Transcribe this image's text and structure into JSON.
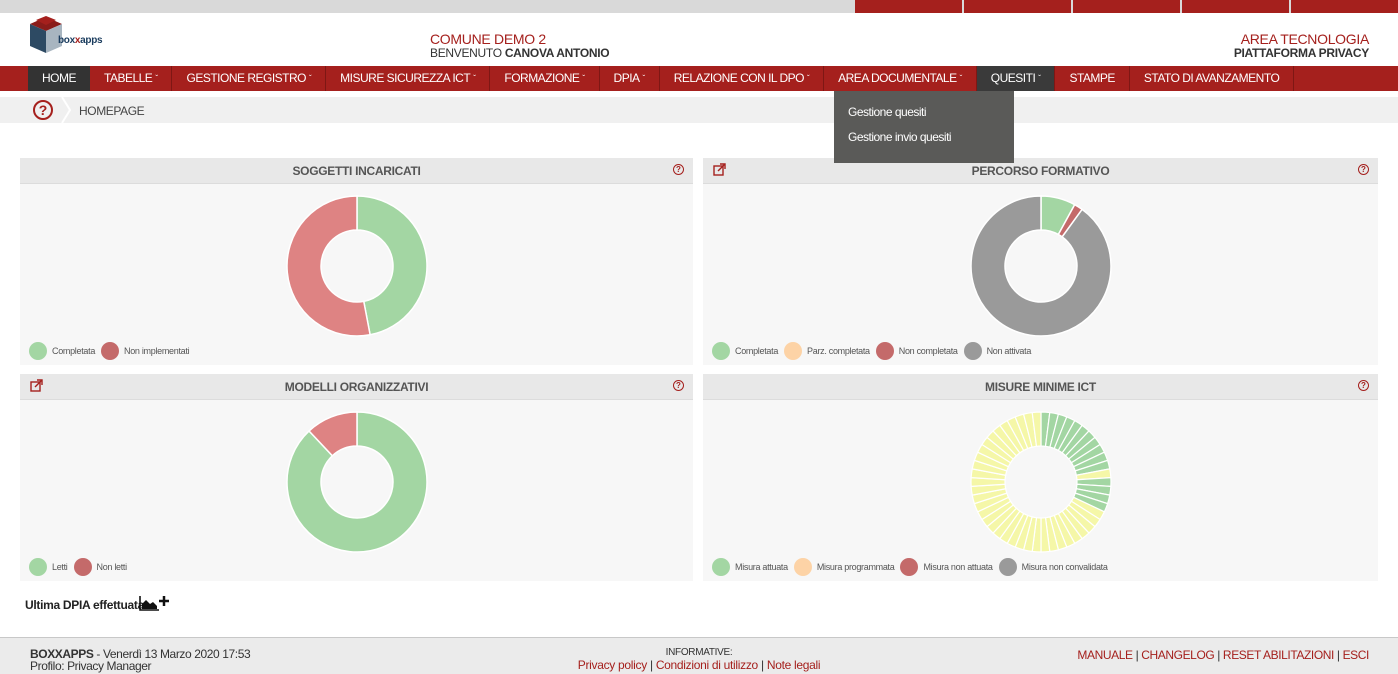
{
  "header": {
    "logo_text_a": "box",
    "logo_text_b": "x",
    "logo_text_c": "apps",
    "ente": "COMUNE DEMO 2",
    "welcome_prefix": "BENVENUTO",
    "user_name": "CANOVA ANTONIO",
    "area": "AREA TECNOLOGIA",
    "platform": "PIATTAFORMA PRIVACY"
  },
  "nav": {
    "items": [
      {
        "label": "HOME",
        "has_chevron": false
      },
      {
        "label": "TABELLE",
        "has_chevron": true
      },
      {
        "label": "GESTIONE REGISTRO",
        "has_chevron": true
      },
      {
        "label": "MISURE SICUREZZA ICT",
        "has_chevron": true
      },
      {
        "label": "FORMAZIONE",
        "has_chevron": true
      },
      {
        "label": "DPIA",
        "has_chevron": true
      },
      {
        "label": "RELAZIONE CON IL DPO",
        "has_chevron": true
      },
      {
        "label": "AREA DOCUMENTALE",
        "has_chevron": true
      },
      {
        "label": "QUESITI",
        "has_chevron": true
      },
      {
        "label": "STAMPE",
        "has_chevron": false
      },
      {
        "label": "STATO DI AVANZAMENTO",
        "has_chevron": false
      }
    ],
    "chevron": "ˇ",
    "dropdown": [
      "Gestione quesiti",
      "Gestione invio quesiti"
    ]
  },
  "breadcrumb": {
    "help_glyph": "?",
    "label": "HOMEPAGE"
  },
  "panels": {
    "soggetti": {
      "title": "SOGGETTI INCARICATI",
      "legend": [
        {
          "label": "Completata",
          "color": "#a3d6a3"
        },
        {
          "label": "Non implementati",
          "color": "#c46a6a"
        }
      ]
    },
    "percorso": {
      "title": "PERCORSO FORMATIVO",
      "legend": [
        {
          "label": "Completata",
          "color": "#a3d6a3"
        },
        {
          "label": "Parz. completata",
          "color": "#fdd3a6"
        },
        {
          "label": "Non completata",
          "color": "#c46a6a"
        },
        {
          "label": "Non attivata",
          "color": "#9a9a9a"
        }
      ]
    },
    "modelli": {
      "title": "MODELLI ORGANIZZATIVI",
      "legend": [
        {
          "label": "Letti",
          "color": "#a3d6a3"
        },
        {
          "label": "Non letti",
          "color": "#c46a6a"
        }
      ]
    },
    "misure": {
      "title": "MISURE MINIME ICT",
      "legend": [
        {
          "label": "Misura attuata",
          "color": "#a3d6a3"
        },
        {
          "label": "Misura programmata",
          "color": "#fdd3a6"
        },
        {
          "label": "Misura non attuata",
          "color": "#c46a6a"
        },
        {
          "label": "Misura non convalidata",
          "color": "#9a9a9a"
        }
      ]
    },
    "help_glyph": "?"
  },
  "chart_data": [
    {
      "type": "pie",
      "title": "SOGGETTI INCARICATI",
      "slices": [
        {
          "name": "Completata",
          "value": 47,
          "color": "#a3d6a3"
        },
        {
          "name": "Non implementati",
          "value": 53,
          "color": "#de8383"
        }
      ]
    },
    {
      "type": "pie",
      "title": "PERCORSO FORMATIVO",
      "slices": [
        {
          "name": "Completata",
          "value": 8,
          "color": "#a3d6a3"
        },
        {
          "name": "Non completata",
          "value": 2,
          "color": "#c46a6a"
        },
        {
          "name": "Non attivata",
          "value": 90,
          "color": "#9a9a9a"
        }
      ]
    },
    {
      "type": "pie",
      "title": "MODELLI ORGANIZZATIVI",
      "slices": [
        {
          "name": "Letti",
          "value": 88,
          "color": "#a3d6a3"
        },
        {
          "name": "Non letti",
          "value": 12,
          "color": "#de8383"
        }
      ]
    },
    {
      "type": "pie",
      "title": "MISURE MINIME ICT",
      "slices": [
        {
          "name": "Misura attuata",
          "value": 1,
          "color": "#a3d6a3"
        },
        {
          "name": "Misura attuata",
          "value": 1,
          "color": "#a3d6a3"
        },
        {
          "name": "Misura attuata",
          "value": 1,
          "color": "#a3d6a3"
        },
        {
          "name": "Misura attuata",
          "value": 1,
          "color": "#a3d6a3"
        },
        {
          "name": "Misura attuata",
          "value": 1,
          "color": "#a3d6a3"
        },
        {
          "name": "Misura attuata",
          "value": 1,
          "color": "#a3d6a3"
        },
        {
          "name": "Misura attuata",
          "value": 1,
          "color": "#a3d6a3"
        },
        {
          "name": "Misura attuata",
          "value": 1,
          "color": "#a3d6a3"
        },
        {
          "name": "Misura attuata",
          "value": 1,
          "color": "#a3d6a3"
        },
        {
          "name": "Misura attuata",
          "value": 1,
          "color": "#a3d6a3"
        },
        {
          "name": "Misura attuata",
          "value": 1,
          "color": "#a3d6a3"
        },
        {
          "name": "Misura programmata",
          "value": 1,
          "color": "#f5f7a8"
        },
        {
          "name": "Misura attuata",
          "value": 1,
          "color": "#a3d6a3"
        },
        {
          "name": "Misura attuata",
          "value": 1,
          "color": "#a3d6a3"
        },
        {
          "name": "Misura attuata",
          "value": 1,
          "color": "#a3d6a3"
        },
        {
          "name": "Misura attuata",
          "value": 1,
          "color": "#a3d6a3"
        },
        {
          "name": "Misura programmata",
          "value": 1,
          "color": "#f5f7a8"
        },
        {
          "name": "Misura programmata",
          "value": 1,
          "color": "#f5f7a8"
        },
        {
          "name": "Misura programmata",
          "value": 1,
          "color": "#f5f7a8"
        },
        {
          "name": "Misura programmata",
          "value": 1,
          "color": "#f5f7a8"
        },
        {
          "name": "Misura programmata",
          "value": 1,
          "color": "#f5f7a8"
        },
        {
          "name": "Misura programmata",
          "value": 1,
          "color": "#f5f7a8"
        },
        {
          "name": "Misura programmata",
          "value": 1,
          "color": "#f5f7a8"
        },
        {
          "name": "Misura programmata",
          "value": 1,
          "color": "#f5f7a8"
        },
        {
          "name": "Misura programmata",
          "value": 1,
          "color": "#f5f7a8"
        },
        {
          "name": "Misura programmata",
          "value": 1,
          "color": "#f5f7a8"
        },
        {
          "name": "Misura programmata",
          "value": 1,
          "color": "#f5f7a8"
        },
        {
          "name": "Misura programmata",
          "value": 1,
          "color": "#f5f7a8"
        },
        {
          "name": "Misura programmata",
          "value": 1,
          "color": "#f5f7a8"
        },
        {
          "name": "Misura programmata",
          "value": 1,
          "color": "#f5f7a8"
        },
        {
          "name": "Misura programmata",
          "value": 1,
          "color": "#f5f7a8"
        },
        {
          "name": "Misura programmata",
          "value": 1,
          "color": "#f5f7a8"
        },
        {
          "name": "Misura programmata",
          "value": 1,
          "color": "#f5f7a8"
        },
        {
          "name": "Misura programmata",
          "value": 1,
          "color": "#f5f7a8"
        },
        {
          "name": "Misura programmata",
          "value": 1,
          "color": "#f5f7a8"
        },
        {
          "name": "Misura programmata",
          "value": 1,
          "color": "#f5f7a8"
        },
        {
          "name": "Misura programmata",
          "value": 1,
          "color": "#f5f7a8"
        },
        {
          "name": "Misura programmata",
          "value": 1,
          "color": "#f5f7a8"
        },
        {
          "name": "Misura programmata",
          "value": 1,
          "color": "#f5f7a8"
        },
        {
          "name": "Misura programmata",
          "value": 1,
          "color": "#f5f7a8"
        },
        {
          "name": "Misura programmata",
          "value": 1,
          "color": "#f5f7a8"
        },
        {
          "name": "Misura programmata",
          "value": 1,
          "color": "#f5f7a8"
        },
        {
          "name": "Misura programmata",
          "value": 1,
          "color": "#f5f7a8"
        },
        {
          "name": "Misura programmata",
          "value": 1,
          "color": "#f5f7a8"
        },
        {
          "name": "Misura programmata",
          "value": 1,
          "color": "#f5f7a8"
        },
        {
          "name": "Misura programmata",
          "value": 1,
          "color": "#f5f7a8"
        },
        {
          "name": "Misura programmata",
          "value": 1,
          "color": "#f5f7a8"
        },
        {
          "name": "Misura programmata",
          "value": 1,
          "color": "#f5f7a8"
        },
        {
          "name": "Misura programmata",
          "value": 1,
          "color": "#f5f7a8"
        },
        {
          "name": "Misura programmata",
          "value": 1,
          "color": "#f5f7a8"
        }
      ]
    }
  ],
  "dpia": {
    "label": "Ultima DPIA effettuata"
  },
  "footer": {
    "brand": "BOXXAPPS",
    "datetime": " - Venerdì 13 Marzo 2020 17:53",
    "profile": "Profilo: Privacy Manager",
    "informative": "INFORMATIVE:",
    "privacy": "Privacy policy",
    "conditions": "Condizioni di utilizzo",
    "legal": "Note legali",
    "manual": "MANUALE",
    "changelog": "CHANGELOG",
    "reset": "RESET ABILITAZIONI",
    "exit": "ESCI",
    "sep": " | "
  }
}
